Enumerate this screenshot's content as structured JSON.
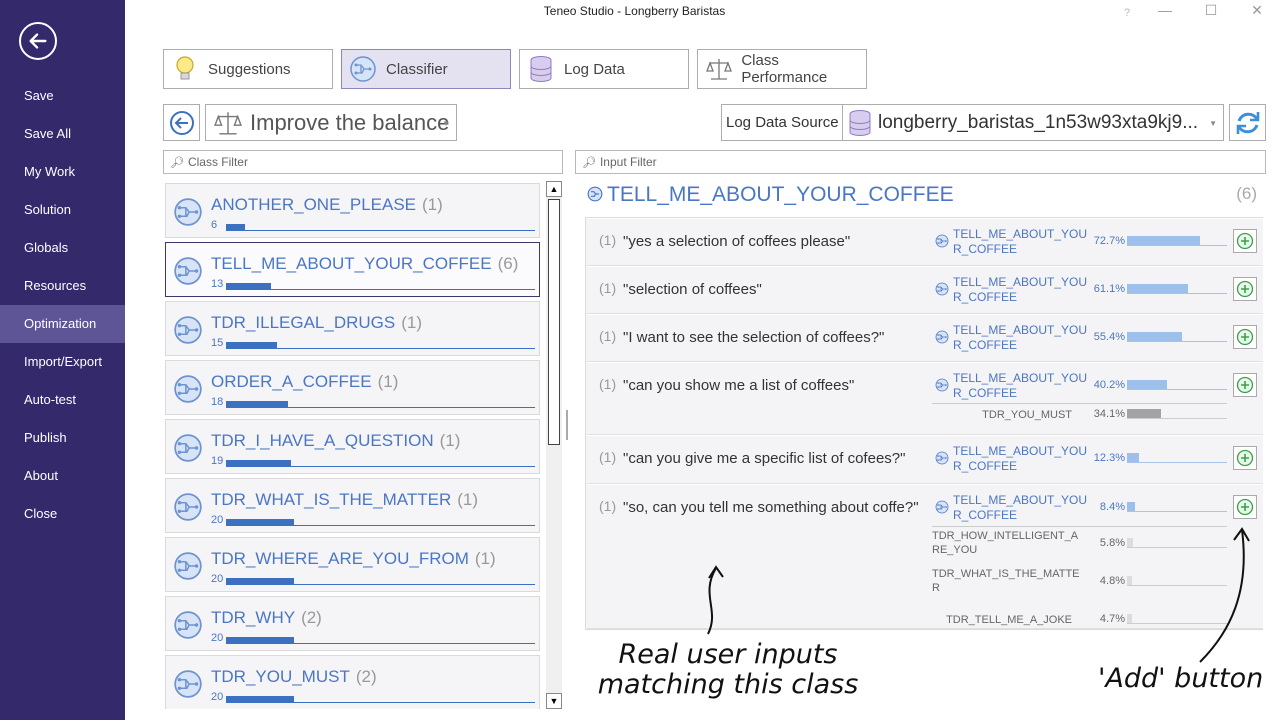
{
  "window": {
    "title": "Teneo Studio - Longberry Baristas",
    "help": "?",
    "minimize": "—",
    "maximize": "☐",
    "close": "✕"
  },
  "sidebar": {
    "items": [
      {
        "label": "Save"
      },
      {
        "label": "Save All"
      },
      {
        "label": "My Work"
      },
      {
        "label": "Solution"
      },
      {
        "label": "Globals"
      },
      {
        "label": "Resources"
      },
      {
        "label": "Optimization"
      },
      {
        "label": "Import/Export"
      },
      {
        "label": "Auto-test"
      },
      {
        "label": "Publish"
      },
      {
        "label": "About"
      },
      {
        "label": "Close"
      }
    ],
    "active": "Optimization"
  },
  "tabs": [
    {
      "label": "Suggestions",
      "icon": "lightbulb-icon"
    },
    {
      "label": "Classifier",
      "icon": "classifier-icon"
    },
    {
      "label": "Log Data",
      "icon": "database-icon"
    },
    {
      "label": "Class Performance",
      "icon": "scales-icon"
    }
  ],
  "toolbar": {
    "balance_label": "Improve the balance",
    "log_source_label": "Log Data Source",
    "log_source_value": "longberry_baristas_1n53w93xta9kj9..."
  },
  "filters": {
    "class_filter": "Class Filter",
    "input_filter": "Input Filter"
  },
  "classes": [
    {
      "name": "ANOTHER_ONE_PLEASE",
      "count": "(1)",
      "num": "6",
      "fill": 0.06
    },
    {
      "name": "TELL_ME_ABOUT_YOUR_COFFEE",
      "count": "(6)",
      "num": "13",
      "fill": 0.145
    },
    {
      "name": "TDR_ILLEGAL_DRUGS",
      "count": "(1)",
      "num": "15",
      "fill": 0.165
    },
    {
      "name": "ORDER_A_COFFEE",
      "count": "(1)",
      "num": "18",
      "fill": 0.2
    },
    {
      "name": "TDR_I_HAVE_A_QUESTION",
      "count": "(1)",
      "num": "19",
      "fill": 0.21
    },
    {
      "name": "TDR_WHAT_IS_THE_MATTER",
      "count": "(1)",
      "num": "20",
      "fill": 0.22
    },
    {
      "name": "TDR_WHERE_ARE_YOU_FROM",
      "count": "(1)",
      "num": "20",
      "fill": 0.22
    },
    {
      "name": "TDR_WHY",
      "count": "(2)",
      "num": "20",
      "fill": 0.22
    },
    {
      "name": "TDR_YOU_MUST",
      "count": "(2)",
      "num": "20",
      "fill": 0.22
    }
  ],
  "detail": {
    "title": "TELL_ME_ABOUT_YOUR_COFFEE",
    "count": "(6)",
    "rows": [
      {
        "count": "(1)",
        "text": "\"yes a selection of coffees please\"",
        "match": "TELL_ME_ABOUT_YOU\nR_COFFEE",
        "pct": "72.7%",
        "fill": 0.727,
        "subs": []
      },
      {
        "count": "(1)",
        "text": "\"selection of coffees\"",
        "match": "TELL_ME_ABOUT_YOU\nR_COFFEE",
        "pct": "61.1%",
        "fill": 0.611,
        "subs": []
      },
      {
        "count": "(1)",
        "text": "\"I want to see the selection of coffees?\"",
        "match": "TELL_ME_ABOUT_YOU\nR_COFFEE",
        "pct": "55.4%",
        "fill": 0.554,
        "subs": []
      },
      {
        "count": "(1)",
        "text": "\"can you show me a list of coffees\"",
        "match": "TELL_ME_ABOUT_YOU\nR_COFFEE",
        "pct": "40.2%",
        "fill": 0.402,
        "subs": [
          {
            "name": "TDR_YOU_MUST",
            "pct": "34.1%",
            "fill": 0.341
          }
        ]
      },
      {
        "count": "(1)",
        "text": "\"can you give me a specific list of cofees?\"",
        "match": "TELL_ME_ABOUT_YOU\nR_COFFEE",
        "pct": "12.3%",
        "fill": 0.123,
        "subs": []
      },
      {
        "count": "(1)",
        "text": "\"so, can you tell me something about coffe?\"",
        "match": "TELL_ME_ABOUT_YOU\nR_COFFEE",
        "pct": "8.4%",
        "fill": 0.084,
        "subs": [
          {
            "name": "TDR_HOW_INTELLIGENT_A\nRE_YOU",
            "pct": "5.8%",
            "fill": 0.058
          },
          {
            "name": "TDR_WHAT_IS_THE_MATTE\nR",
            "pct": "4.8%",
            "fill": 0.048
          },
          {
            "name": "TDR_TELL_ME_A_JOKE",
            "pct": "4.7%",
            "fill": 0.047
          }
        ]
      }
    ]
  },
  "annotations": {
    "inputs": "Real user inputs\nmatching this class",
    "add": "'Add' button"
  },
  "colors": {
    "sidebar": "#33296b",
    "sidebar_active": "#5e5597",
    "accent": "#4a76c6",
    "bar": "#3c70c0",
    "match_bar": "#9dc0ea",
    "other_bar": "#a3a3a3",
    "add_green": "#3aa14a"
  }
}
